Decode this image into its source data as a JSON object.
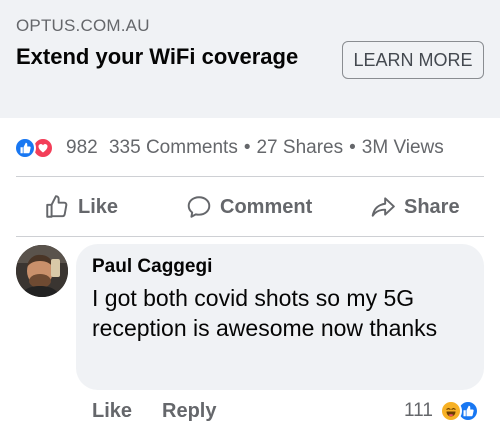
{
  "ad": {
    "domain": "OPTUS.COM.AU",
    "headline": "Extend your WiFi coverage",
    "cta_label": "LEARN MORE"
  },
  "stats": {
    "reactions_count": "982",
    "comments": "335 Comments",
    "separator": "•",
    "shares": "27 Shares",
    "views": "3M Views",
    "reaction_icons": [
      "like-reaction-icon",
      "love-reaction-icon"
    ]
  },
  "actions": {
    "like_label": "Like",
    "comment_label": "Comment",
    "share_label": "Share"
  },
  "comment": {
    "author": "Paul Caggegi",
    "text": "I got both covid shots so my 5G reception is awesome now thanks",
    "like_label": "Like",
    "reply_label": "Reply",
    "reaction_count": "111",
    "reaction_icons": [
      "haha-reaction-icon",
      "like-reaction-icon"
    ]
  },
  "colors": {
    "brand_blue": "#1877f2",
    "love_red": "#f33e58",
    "haha_yellow": "#f7b125",
    "secondary_text": "#65676b",
    "bubble_bg": "#f0f2f5"
  }
}
